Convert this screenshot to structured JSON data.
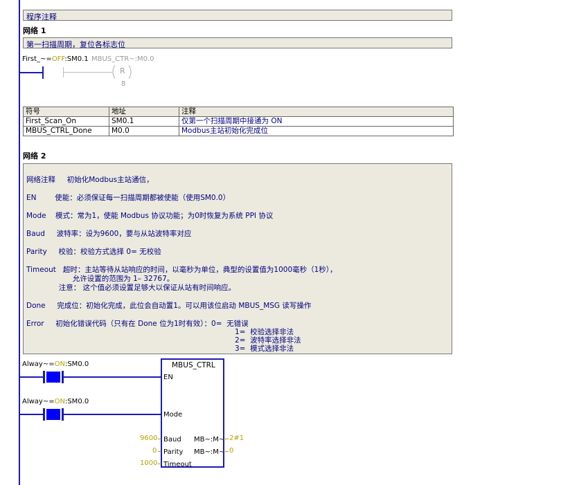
{
  "program_comment": "程序注释",
  "network1": {
    "label": "网络 1",
    "comment": "第一扫描周期，复位各标志位",
    "contact": {
      "symbol": "First_~=",
      "state": "OFF",
      "address": ":SM0.1"
    },
    "coil": {
      "operand": "MBUS_CTR~:M0.0",
      "type": "R",
      "count": "8"
    },
    "symbol_table": {
      "headers": [
        "符号",
        "地址",
        "注释"
      ],
      "rows": [
        [
          "First_Scan_On",
          "SM0.1",
          "仅第一个扫描周期中接通为 ON"
        ],
        [
          "MBUS_CTRL_Done",
          "M0.0",
          "Modbus主站初始化完成位"
        ]
      ]
    }
  },
  "network2": {
    "label": "网络 2",
    "comment_lines": [
      "网络注释     初始化Modbus主站通信，",
      "EN        使能：必须保证每一扫描周期都被使能（使用SM0.0）",
      "Mode    模式：常为1，使能 Modbus 协议功能；为0时恢复为系统 PPI 协议",
      "Baud     波特率：设为9600，要与从站波特率对应",
      "Parity     校验：校验方式选择 0= 无校验",
      "Timeout   超时：主站等待从站响应的时间，以毫秒为单位，典型的设置值为1000毫秒（1秒），",
      "                    允许设置的范围为 1– 32767。",
      "              注意： 这个值必须设置足够大以保证从站有时间响应。",
      "Done     完成位：初始化完成，此位会自动置1。可以用该位启动 MBUS_MSG 读写操作",
      "Error     初始化错误代码（只有在 Done 位为1时有效）：0=  无错误",
      "1=  校验选择非法",
      "2=  波特率选择非法",
      "3=  模式选择非法"
    ],
    "contact1": {
      "symbol": "Alway~=",
      "state": "ON",
      "address": ":SM0.0"
    },
    "contact2": {
      "symbol": "Alway~=",
      "state": "ON",
      "address": ":SM0.0"
    },
    "block": {
      "title": "MBUS_CTRL",
      "pin_en": "EN",
      "pin_mode": "Mode",
      "pin_baud": "Baud",
      "pin_parity": "Parity",
      "pin_timeout": "Timeout",
      "out_done": "MB~:M~",
      "out_error": "MB~:M~",
      "in_baud_value": "9600",
      "in_parity_value": "0",
      "in_timeout_value": "1000",
      "out_done_value": "2#1",
      "out_error_value": "0"
    }
  },
  "colors": {
    "rail": "#1a1ab3",
    "contact_on": "#0000ff",
    "comment_text": "#000080",
    "off_state": "#b5a200"
  }
}
